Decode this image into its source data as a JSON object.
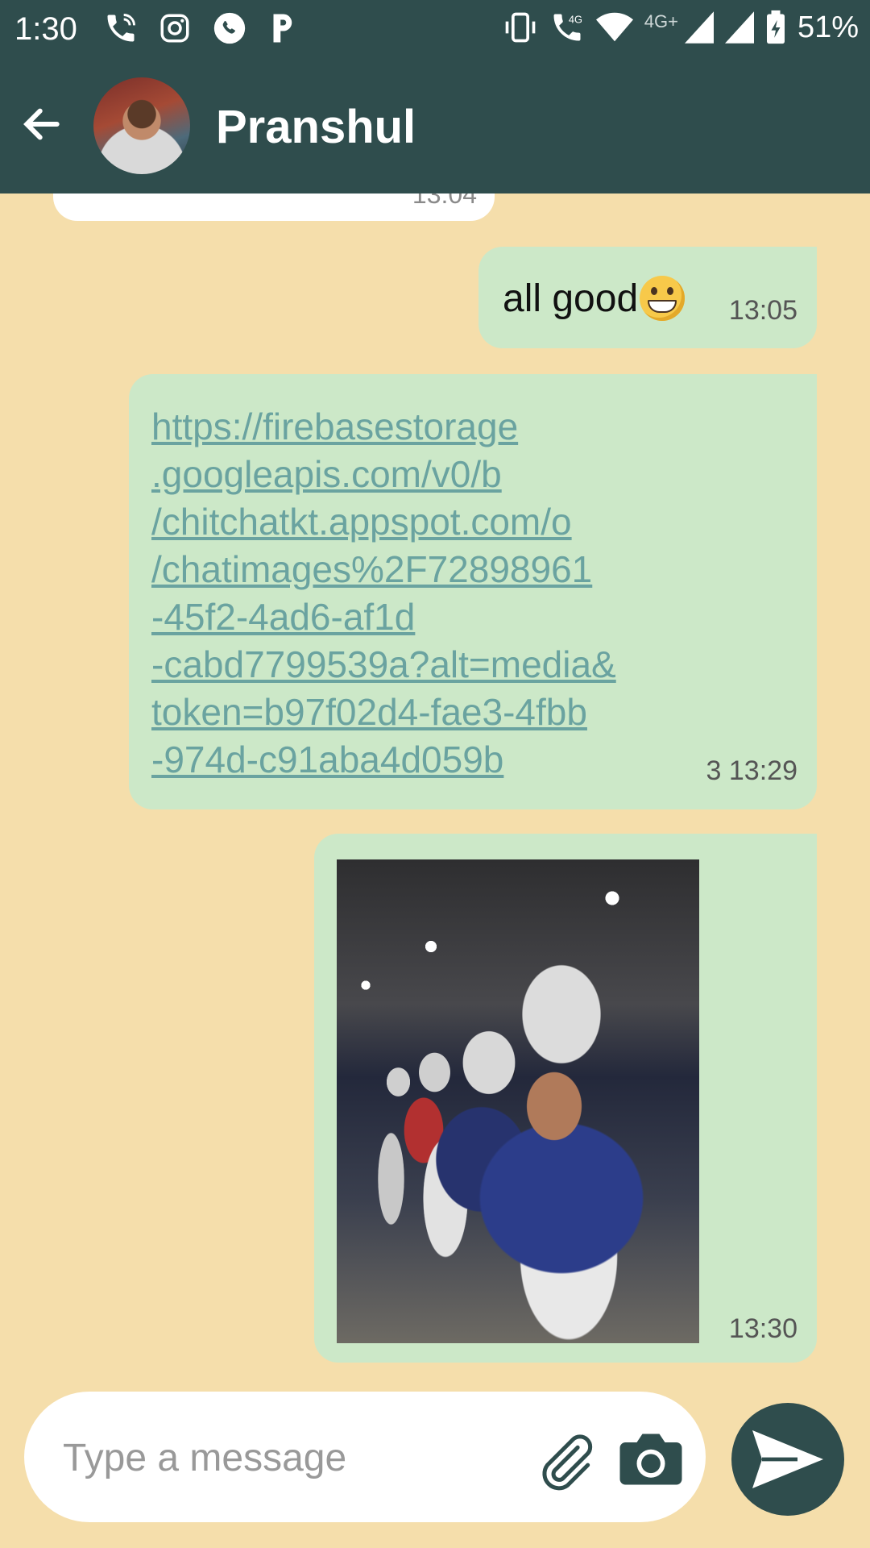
{
  "status_bar": {
    "time": "1:30",
    "network_label": "4G+",
    "battery_percent": "51%",
    "left_icons": [
      "wifi-calling-icon",
      "instagram-icon",
      "whatsapp-icon",
      "paytm-icon"
    ],
    "right_icons": [
      "vibrate-icon",
      "volte-call-icon",
      "wifi-icon",
      "signal-icon",
      "signal-icon",
      "battery-charging-icon"
    ]
  },
  "header": {
    "contact_name": "Pranshul",
    "back_icon": "arrow-left-icon"
  },
  "messages": [
    {
      "direction": "received",
      "time": "13:04"
    },
    {
      "direction": "sent",
      "text": "all good",
      "emoji": "grinning-face",
      "time": "13:05"
    },
    {
      "direction": "sent",
      "link_lines": [
        "https://firebasestorage",
        ".googleapis.com/v0/b",
        "/chitchatkt.appspot.com/o",
        "/chatimages%2F72898961",
        "-45f2-4ad6-af1d",
        "-cabd7799539a?alt=media&",
        "token=b97f02d4-fae3-4fbb",
        "-974d-c91aba4d059b"
      ],
      "time": "3 13:29"
    },
    {
      "direction": "sent",
      "type": "image",
      "time": "13:30"
    }
  ],
  "composer": {
    "placeholder": "Type a message",
    "attach_icon": "paperclip-icon",
    "camera_icon": "camera-icon",
    "send_icon": "send-icon"
  },
  "colors": {
    "primary": "#2f4d4d",
    "chat_background": "#f5deab",
    "sent_bubble": "#cce8c8",
    "received_bubble": "#ffffff",
    "link": "#6aa3a0"
  }
}
